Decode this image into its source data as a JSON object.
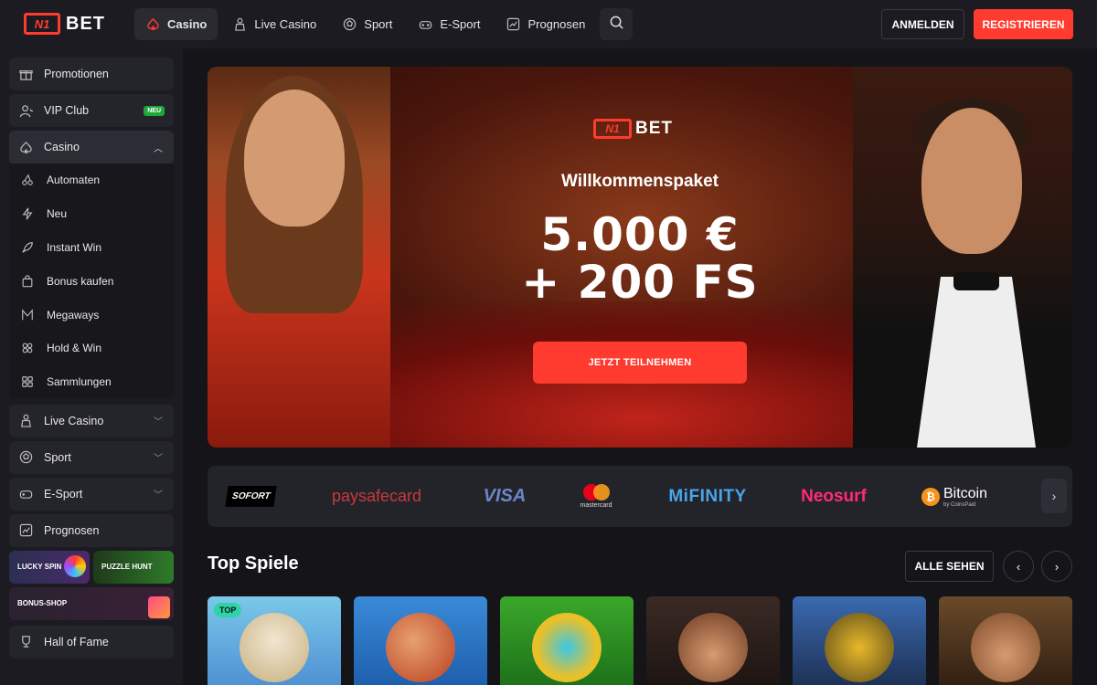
{
  "brand": {
    "logo_mark": "N1",
    "logo_text": "BET"
  },
  "nav": {
    "items": [
      {
        "label": "Casino",
        "icon": "spade-icon",
        "active": true
      },
      {
        "label": "Live Casino",
        "icon": "dealer-icon"
      },
      {
        "label": "Sport",
        "icon": "ball-icon"
      },
      {
        "label": "E-Sport",
        "icon": "gamepad-icon"
      },
      {
        "label": "Prognosen",
        "icon": "chart-icon"
      }
    ],
    "search_icon": "search-icon"
  },
  "auth": {
    "login_label": "ANMELDEN",
    "register_label": "REGISTRIEREN"
  },
  "sidebar": {
    "promotions": "Promotionen",
    "vip": "VIP Club",
    "vip_badge": "NEU",
    "casino": "Casino",
    "casino_sub": [
      "Automaten",
      "Neu",
      "Instant Win",
      "Bonus kaufen",
      "Megaways",
      "Hold & Win",
      "Sammlungen"
    ],
    "live_casino": "Live Casino",
    "sport": "Sport",
    "esport": "E-Sport",
    "prognosen": "Prognosen",
    "promo_lucky": "LUCKY SPIN",
    "promo_puzzle": "PUZZLE HUNT",
    "promo_bonus": "BONUS-SHOP",
    "hall_of_fame": "Hall of Fame"
  },
  "hero": {
    "title": "Willkommenspaket",
    "amount_line1": "5.000 €",
    "amount_line2": "+ 200 FS",
    "cta": "JETZT TEILNEHMEN"
  },
  "payments": {
    "sofort": "SOFORT",
    "paysafecard": "paysafecard",
    "visa": "VISA",
    "mastercard": "mastercard",
    "mifinity": "MiFINITY",
    "neosurf": "Neosurf",
    "bitcoin": "Bitcoin",
    "bitcoin_sub": "by CoinsPaid"
  },
  "top_games": {
    "title": "Top Spiele",
    "see_all": "ALLE SEHEN",
    "tag_top": "TOP"
  },
  "colors": {
    "accent": "#ff3b2f",
    "bg": "#141419",
    "panel": "#1b1b21"
  }
}
